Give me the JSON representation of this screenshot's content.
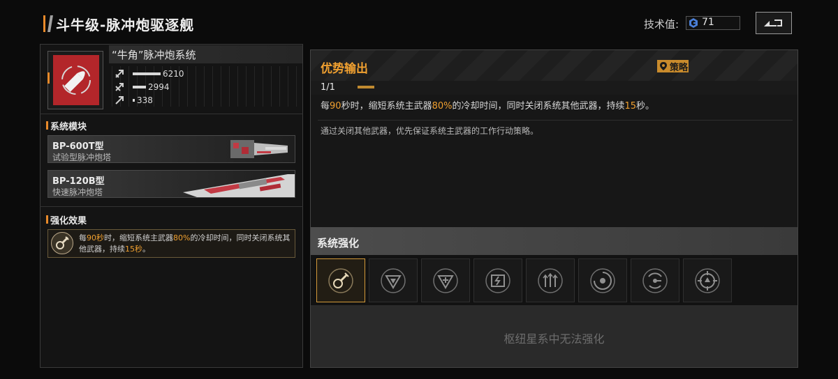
{
  "header": {
    "title": "斗牛级-脉冲炮驱逐舰",
    "tech_label": "技术值:",
    "tech_value": "71"
  },
  "weapon": {
    "name": "“牛角”脉冲炮系统",
    "stats": [
      {
        "icon": "attack-icon",
        "value": "6210",
        "fraction": 0.26
      },
      {
        "icon": "durability-icon",
        "value": "2994",
        "fraction": 0.12
      },
      {
        "icon": "range-icon",
        "value": "338",
        "fraction": 0.02
      }
    ]
  },
  "modules": {
    "label": "系统模块",
    "items": [
      {
        "name": "BP-600T型",
        "sub": "试验型脉冲炮塔"
      },
      {
        "name": "BP-120B型",
        "sub": "快速脉冲炮塔"
      }
    ]
  },
  "effects": {
    "label": "强化效果",
    "text_parts": [
      "每",
      "90秒",
      "时，缩短系统主武器",
      "80%",
      "的冷却时间，同时关闭系统其他武器，持续",
      "15秒",
      "。"
    ]
  },
  "detail": {
    "title": "优势输出",
    "tag": "策略",
    "page": "1/1",
    "desc_parts": [
      "每",
      "90",
      "秒时，缩短系统主武器",
      "80%",
      "的冷却时间，同时关闭系统其他武器，持续",
      "15",
      "秒。"
    ],
    "desc2": "通过关闭其他武器，优先保证系统主武器的工作行动策略。"
  },
  "enhance": {
    "title": "系统强化",
    "slots": [
      "cannon-wrench-icon",
      "shield-triangle-icon",
      "shield-burst-icon",
      "battery-icon",
      "triple-arrow-icon",
      "vortex-icon",
      "radar-icon",
      "target-icon"
    ],
    "active_index": 0,
    "message": "枢纽星系中无法强化"
  },
  "colors": {
    "accent": "#f0a030",
    "weapon_red": "#b3262a"
  }
}
